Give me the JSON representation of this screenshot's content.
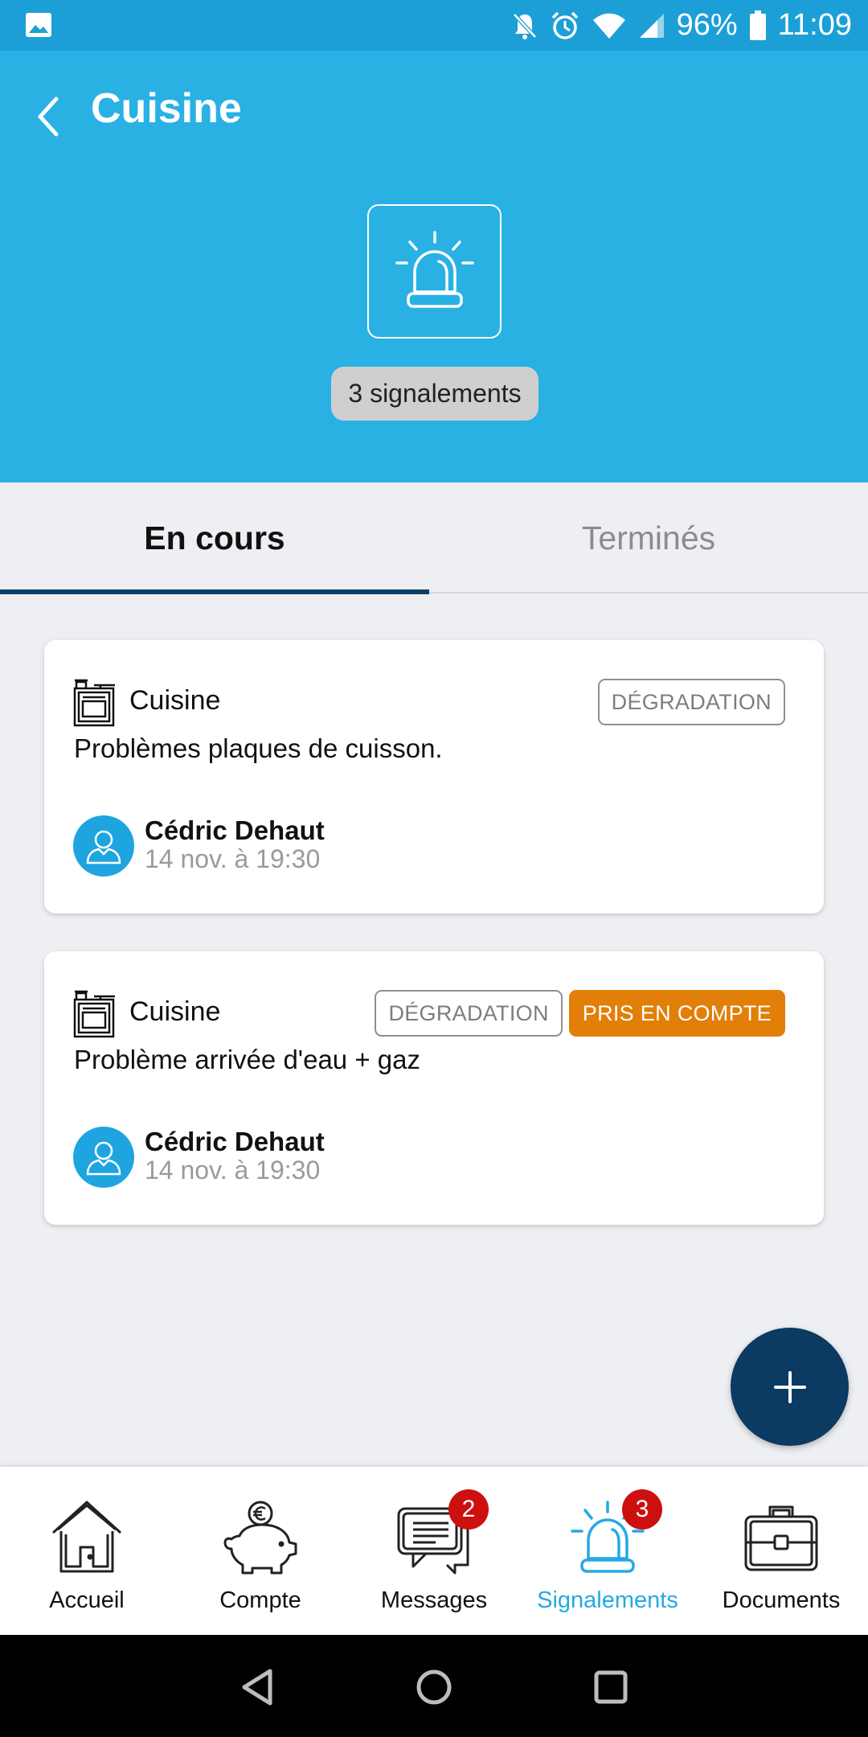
{
  "status_bar": {
    "battery": "96%",
    "time": "11:09",
    "icons": [
      "image-icon",
      "bell-off-icon",
      "alarm-icon",
      "wifi-icon",
      "signal-icon",
      "battery-icon"
    ]
  },
  "header": {
    "title": "Cuisine",
    "icon": "alarm-siren-icon",
    "count_label": "3 signalements",
    "background": "#29b1e4"
  },
  "tabs": [
    {
      "label": "En cours",
      "active": true
    },
    {
      "label": "Terminés",
      "active": false
    }
  ],
  "cards": [
    {
      "room": "Cuisine",
      "room_icon": "stove-icon",
      "description": "Problèmes plaques de cuisson.",
      "tags": [
        "DÉGRADATION"
      ],
      "author": "Cédric Dehaut",
      "date": "14 nov. à 19:30"
    },
    {
      "room": "Cuisine",
      "room_icon": "stove-icon",
      "description": "Problème arrivée d'eau + gaz",
      "tags": [
        "DÉGRADATION",
        "PRIS EN COMPTE"
      ],
      "author": "Cédric Dehaut",
      "date": "14 nov. à 19:30"
    }
  ],
  "fab": {
    "icon": "plus-icon",
    "color": "#0b3a63"
  },
  "bottom_nav": [
    {
      "label": "Accueil",
      "icon": "home-icon"
    },
    {
      "label": "Compte",
      "icon": "piggy-bank-icon"
    },
    {
      "label": "Messages",
      "icon": "messages-icon",
      "badge": "2"
    },
    {
      "label": "Signalements",
      "icon": "alarm-siren-icon",
      "badge": "3",
      "active": true
    },
    {
      "label": "Documents",
      "icon": "briefcase-icon"
    }
  ],
  "colors": {
    "accent": "#25a9e3",
    "dark_blue": "#0b3a63",
    "status_orange": "#e27f08",
    "badge_red": "#cc1010"
  }
}
